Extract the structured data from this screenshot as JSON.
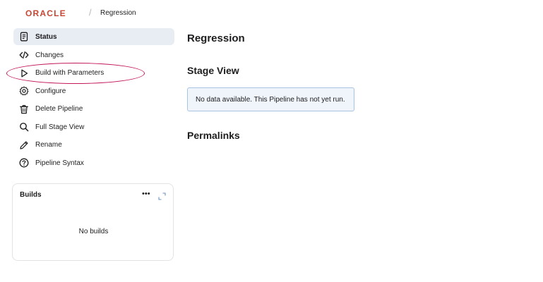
{
  "header": {
    "logo_text": "ORACLE",
    "breadcrumb_separator": "/",
    "breadcrumb": "Regression"
  },
  "sidebar": {
    "items": [
      {
        "label": "Status",
        "icon": "status-document-icon",
        "active": true
      },
      {
        "label": "Changes",
        "icon": "code-icon"
      },
      {
        "label": "Build with Parameters",
        "icon": "play-icon"
      },
      {
        "label": "Configure",
        "icon": "gear-icon"
      },
      {
        "label": "Delete Pipeline",
        "icon": "trash-icon"
      },
      {
        "label": "Full Stage View",
        "icon": "search-icon"
      },
      {
        "label": "Rename",
        "icon": "pencil-icon"
      },
      {
        "label": "Pipeline Syntax",
        "icon": "help-icon"
      }
    ]
  },
  "builds": {
    "title": "Builds",
    "more": "•••",
    "empty_text": "No builds"
  },
  "main": {
    "title": "Regression",
    "stage_view_title": "Stage View",
    "notice": "No data available. This Pipeline has not yet run.",
    "permalinks_title": "Permalinks"
  },
  "colors": {
    "oracle_red": "#c74634",
    "active_bg": "#e8ecf3",
    "notice_border": "#a9c3e3",
    "notice_bg": "#f0f5fb",
    "highlight": "#c2185b"
  }
}
